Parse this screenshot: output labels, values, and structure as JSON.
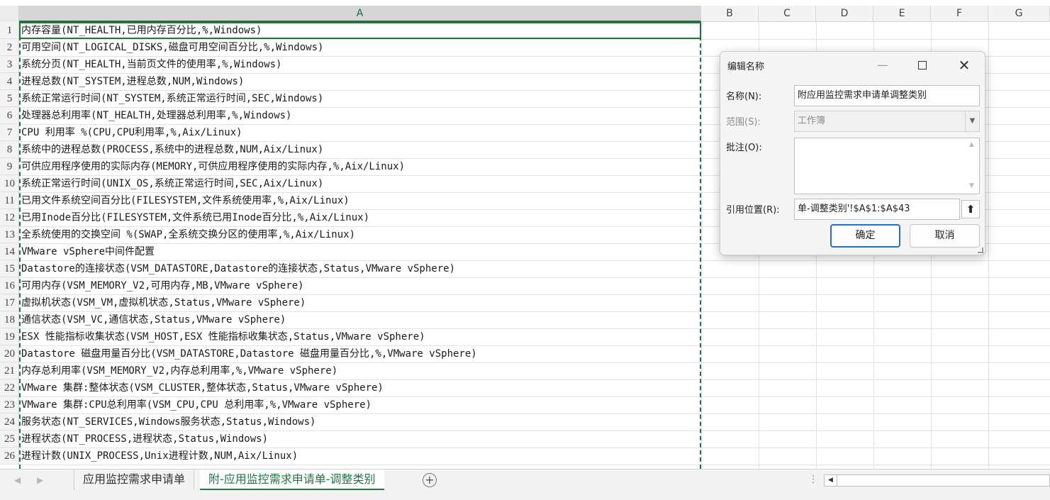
{
  "columns": [
    "A",
    "B",
    "C",
    "D",
    "E",
    "F",
    "G"
  ],
  "rows": [
    "内存容量(NT_HEALTH,已用内存百分比,%,Windows)",
    "可用空间(NT_LOGICAL_DISKS,磁盘可用空间百分比,%,Windows)",
    "系统分页(NT_HEALTH,当前页文件的使用率,%,Windows)",
    "进程总数(NT_SYSTEM,进程总数,NUM,Windows)",
    "系统正常运行时间(NT_SYSTEM,系统正常运行时间,SEC,Windows)",
    "处理器总利用率(NT_HEALTH,处理器总利用率,%,Windows)",
    "CPU 利用率 %(CPU,CPU利用率,%,Aix/Linux)",
    "系统中的进程总数(PROCESS,系统中的进程总数,NUM,Aix/Linux)",
    "可供应用程序使用的实际内存(MEMORY,可供应用程序使用的实际内存,%,Aix/Linux)",
    "系统正常运行时间(UNIX_OS,系统正常运行时间,SEC,Aix/Linux)",
    "已用文件系统空间百分比(FILESYSTEM,文件系统使用率,%,Aix/Linux)",
    "已用Inode百分比(FILESYSTEM,文件系统已用Inode百分比,%,Aix/Linux)",
    "全系统使用的交换空间 %(SWAP,全系统交换分区的使用率,%,Aix/Linux)",
    "VMware vSphere中间件配置",
    "Datastore的连接状态(VSM_DATASTORE,Datastore的连接状态,Status,VMware vSphere)",
    "可用内存(VSM_MEMORY_V2,可用内存,MB,VMware vSphere)",
    "虚拟机状态(VSM_VM,虚拟机状态,Status,VMware vSphere)",
    "通信状态(VSM_VC,通信状态,Status,VMware vSphere)",
    "ESX 性能指标收集状态(VSM_HOST,ESX 性能指标收集状态,Status,VMware vSphere)",
    "Datastore 磁盘用量百分比(VSM_DATASTORE,Datastore 磁盘用量百分比,%,VMware vSphere)",
    "内存总利用率(VSM_MEMORY_V2,内存总利用率,%,VMware vSphere)",
    "VMware 集群:整体状态(VSM_CLUSTER,整体状态,Status,VMware vSphere)",
    "VMware 集群:CPU总利用率(VSM_CPU,CPU 总利用率,%,VMware vSphere)",
    "服务状态(NT_SERVICES,Windows服务状态,Status,Windows)",
    "进程状态(NT_PROCESS,进程状态,Status,Windows)",
    "进程计数(UNIX_PROCESS,Unix进程计数,NUM,Aix/Linux)"
  ],
  "row_numbers": [
    "1",
    "2",
    "3",
    "4",
    "5",
    "6",
    "7",
    "8",
    "9",
    "10",
    "11",
    "12",
    "13",
    "14",
    "15",
    "16",
    "17",
    "18",
    "19",
    "20",
    "21",
    "22",
    "23",
    "24",
    "25",
    "26"
  ],
  "sheet_tabs": {
    "nav_prev": "◀",
    "nav_next": "▶",
    "tab1": "应用监控需求申请单",
    "tab2": "附-应用监控需求申请单-调整类别",
    "add": "+",
    "dots": "⋮",
    "scroll_left": "◀"
  },
  "dialog": {
    "title": "编辑名称",
    "minimize": "—",
    "close": "✕",
    "name_label": "名称(N):",
    "name_value": "附应用监控需求申请单调整类别",
    "scope_label": "范围(S):",
    "scope_value": "工作簿",
    "scope_arrow": "▼",
    "comment_label": "批注(O):",
    "comment_up": "▲",
    "comment_down": "▼",
    "ref_label": "引用位置(R):",
    "ref_value": "单-调整类别'!$A$1:$A$43",
    "collapse": "⬆",
    "ok": "确定",
    "cancel": "取消"
  },
  "colors": {
    "accent": "#217346",
    "primary_button_border": "#1e6fd0"
  }
}
